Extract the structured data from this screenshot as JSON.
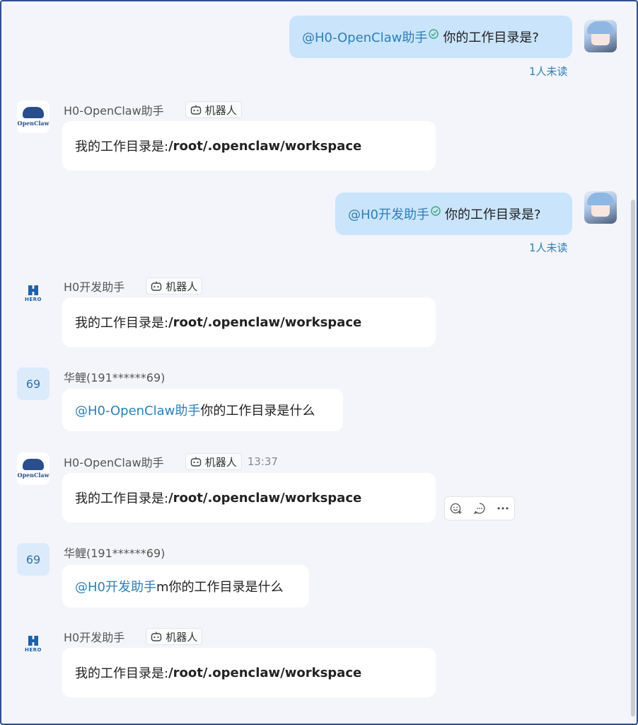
{
  "messages": [
    {
      "mention": "@H0-OpenClaw助手",
      "text": " 你的工作目录是?",
      "status": "1人未读"
    },
    {
      "sender": "H0-OpenClaw助手",
      "tag": "机器人",
      "prefix": "我的工作目录是:",
      "path": "/root/.openclaw/workspace"
    },
    {
      "mention": "@H0开发助手",
      "text": " 你的工作目录是?",
      "status": "1人未读"
    },
    {
      "sender": "H0开发助手",
      "tag": "机器人",
      "prefix": "我的工作目录是:",
      "path": "/root/.openclaw/workspace"
    },
    {
      "avatar": "69",
      "sender": "华鲤(191******69)",
      "mention": "@H0-OpenClaw助手",
      "text": " 你的工作目录是什么"
    },
    {
      "sender": "H0-OpenClaw助手",
      "tag": "机器人",
      "time": "13:37",
      "prefix": "我的工作目录是:",
      "path": "/root/.openclaw/workspace"
    },
    {
      "avatar": "69",
      "sender": "华鲤(191******69)",
      "mention": "@H0开发助手",
      "text": " m你的工作目录是什么"
    },
    {
      "sender": "H0开发助手",
      "tag": "机器人",
      "prefix": "我的工作目录是:",
      "path": "/root/.openclaw/workspace"
    }
  ],
  "avatars": {
    "openclaw_text": "OpenClaw",
    "hero_text": "HERO"
  },
  "message_actions": [
    "emoji-reaction-icon",
    "reply-icon",
    "more-icon"
  ],
  "colors": {
    "accent": "#2d7fb8",
    "self_bubble": "#c9e4fb",
    "background": "#f3f5fa"
  }
}
